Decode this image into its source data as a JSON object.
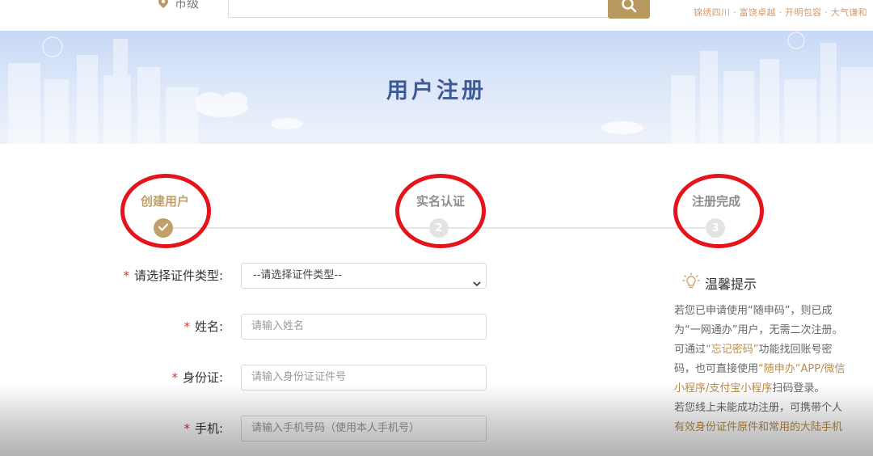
{
  "topbar": {
    "region_label": "市级",
    "search_placeholder": "",
    "slogan": "锦绣四川 · 富饶卓越 · 开明包容 · 大气谦和"
  },
  "banner": {
    "title": "用户注册"
  },
  "steps": [
    {
      "label": "创建用户",
      "state": "done",
      "number": "✓"
    },
    {
      "label": "实名认证",
      "state": "pending",
      "number": "2"
    },
    {
      "label": "注册完成",
      "state": "pending",
      "number": "3"
    }
  ],
  "form": {
    "required_mark": "*",
    "id_type": {
      "label": "请选择证件类型:",
      "selected": "--请选择证件类型--"
    },
    "name": {
      "label": "姓名:",
      "placeholder": "请输入姓名"
    },
    "id_number": {
      "label": "身份证:",
      "placeholder": "请输入身份证证件号"
    },
    "phone": {
      "label": "手机:",
      "placeholder": "请输入手机号码（使用本人手机号）"
    }
  },
  "tips": {
    "title": "温馨提示",
    "p1_a": "若您已申请使用“随申码”，则已成为“一网通办”用户，无需二次注册。",
    "p2_a": "可通过",
    "p2_hl1": "“忘记密码”",
    "p2_b": "功能找回账号密码，也可直接使用",
    "p2_hl2": "“随申办”APP/微信小程序/支付宝小程序",
    "p2_c": "扫码登录。",
    "p3_a": "若您线上未能成功注册，可携带个人",
    "p3_hl": "有效身份证件原件和常用的大陆手机"
  },
  "colors": {
    "accent_gold": "#b89a60",
    "banner_title": "#3d5a96",
    "annotation_ring": "#e3141b",
    "required": "#e0322f"
  },
  "icons": {
    "location": "map-pin-icon",
    "search": "search-icon",
    "check": "check-icon",
    "tips": "lightbulb-icon",
    "dropdown": "chevron-down-icon"
  }
}
